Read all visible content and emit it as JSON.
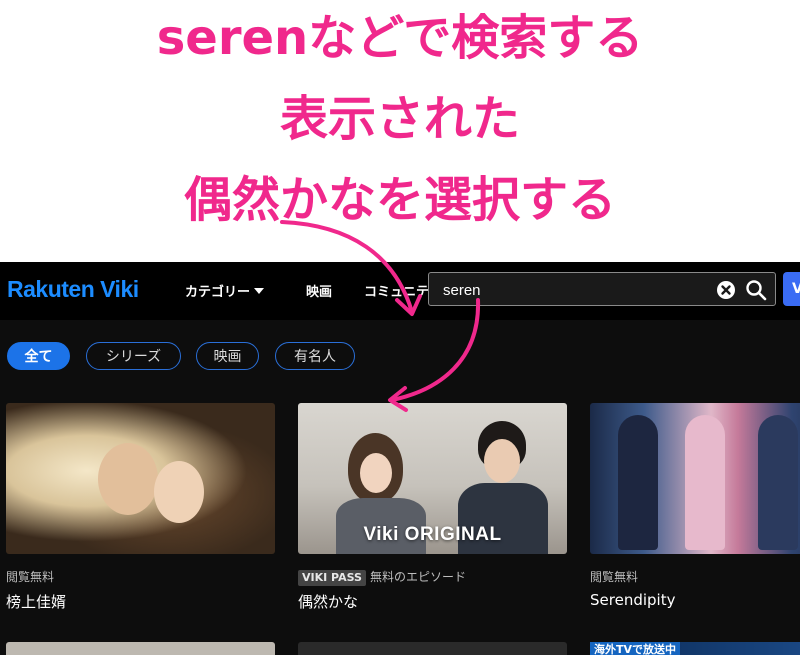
{
  "annotation": {
    "lines": [
      "serenなどで検索する",
      "表示された",
      "偶然かなを選択する"
    ],
    "color": "#f0288c"
  },
  "header": {
    "logo": "Rakuten Viki",
    "nav": [
      "カテゴリー",
      "映画",
      "コミュニティ"
    ],
    "search": {
      "value": "seren",
      "placeholder": ""
    },
    "signup_label": "V"
  },
  "chips": [
    {
      "label": "全て",
      "active": true
    },
    {
      "label": "シリーズ",
      "active": false
    },
    {
      "label": "映画",
      "active": false
    },
    {
      "label": "有名人",
      "active": false
    }
  ],
  "results": [
    {
      "meta": "閲覧無料",
      "badge": "",
      "title": "榜上佳婿"
    },
    {
      "meta": "無料のエピソード",
      "badge": "VIKI PASS",
      "title": "偶然かな",
      "overlay": "Viki ORIGINAL"
    },
    {
      "meta": "閲覧無料",
      "badge": "",
      "title": "Serendipity"
    }
  ],
  "row2": {
    "badge": "海外TVで放送中"
  },
  "colors": {
    "accent": "#1c73e8",
    "logo": "#1c8cff",
    "background": "#0d0d0d"
  }
}
